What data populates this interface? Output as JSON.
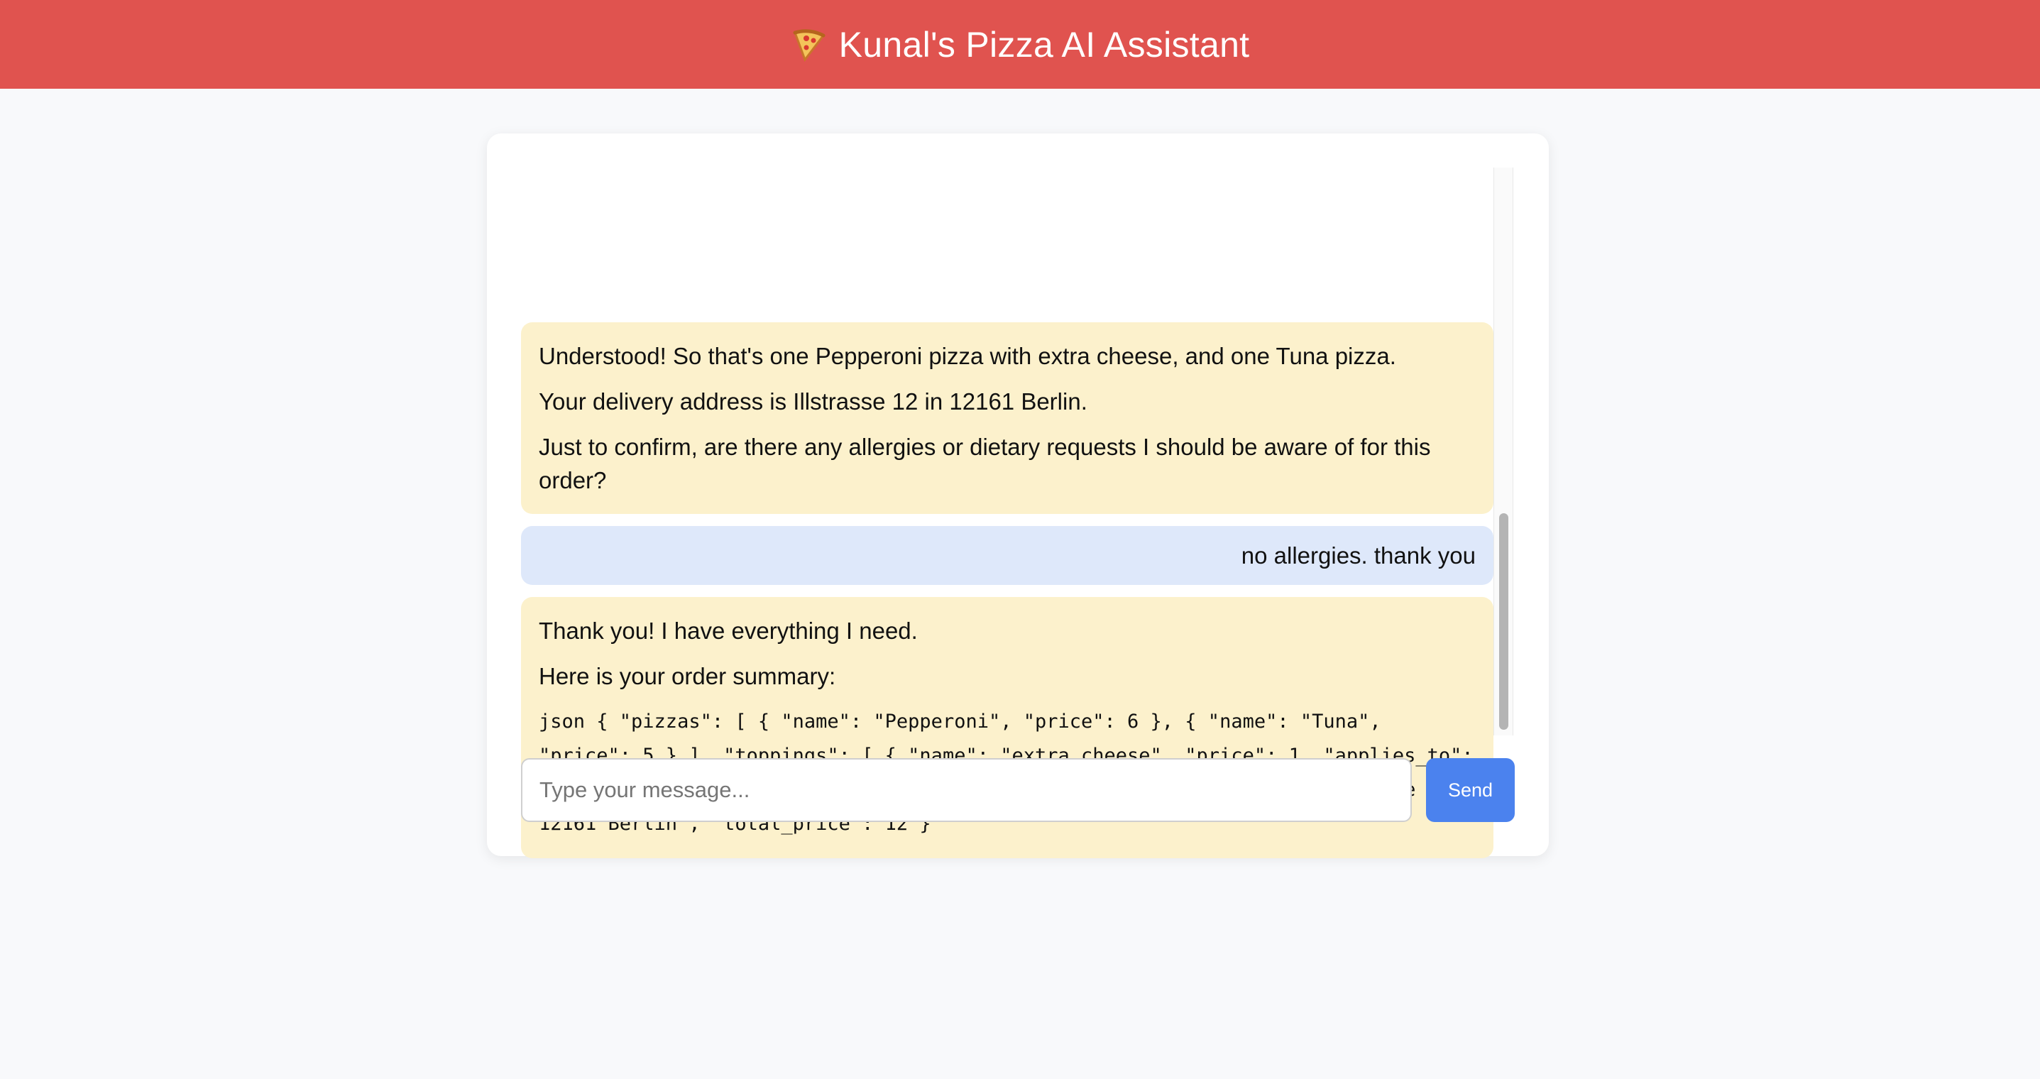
{
  "header": {
    "title": "Kunal's Pizza AI Assistant",
    "icon": "pizza-icon",
    "background_color": "#e0534f"
  },
  "messages": [
    {
      "role": "assistant",
      "paragraphs": [
        "Understood! So that's one Pepperoni pizza with extra cheese, and one Tuna pizza.",
        "Your delivery address is Illstrasse 12 in 12161 Berlin.",
        "Just to confirm, are there any allergies or dietary requests I should be aware of for this order?"
      ]
    },
    {
      "role": "user",
      "text": "no allergies. thank you"
    },
    {
      "role": "assistant",
      "paragraphs": [
        "Thank you! I have everything I need.",
        "Here is your order summary:"
      ],
      "code": "json { \"pizzas\": [ { \"name\": \"Pepperoni\", \"price\": 6 }, { \"name\": \"Tuna\", \"price\": 5 } ], \"toppings\": [ { \"name\": \"extra cheese\", \"price\": 1, \"applies_to\": \"Pepperoni\" } ], \"special_requests\": \"No allergies.\", \"address\": \"Illstrasse 12, 12161 Berlin\", \"total_price\": 12 }"
    }
  ],
  "composer": {
    "placeholder": "Type your message...",
    "value": "",
    "send_label": "Send"
  },
  "colors": {
    "assistant_bubble": "#fcf1cc",
    "user_bubble": "#dee8fa",
    "send_button": "#4b82ee"
  }
}
